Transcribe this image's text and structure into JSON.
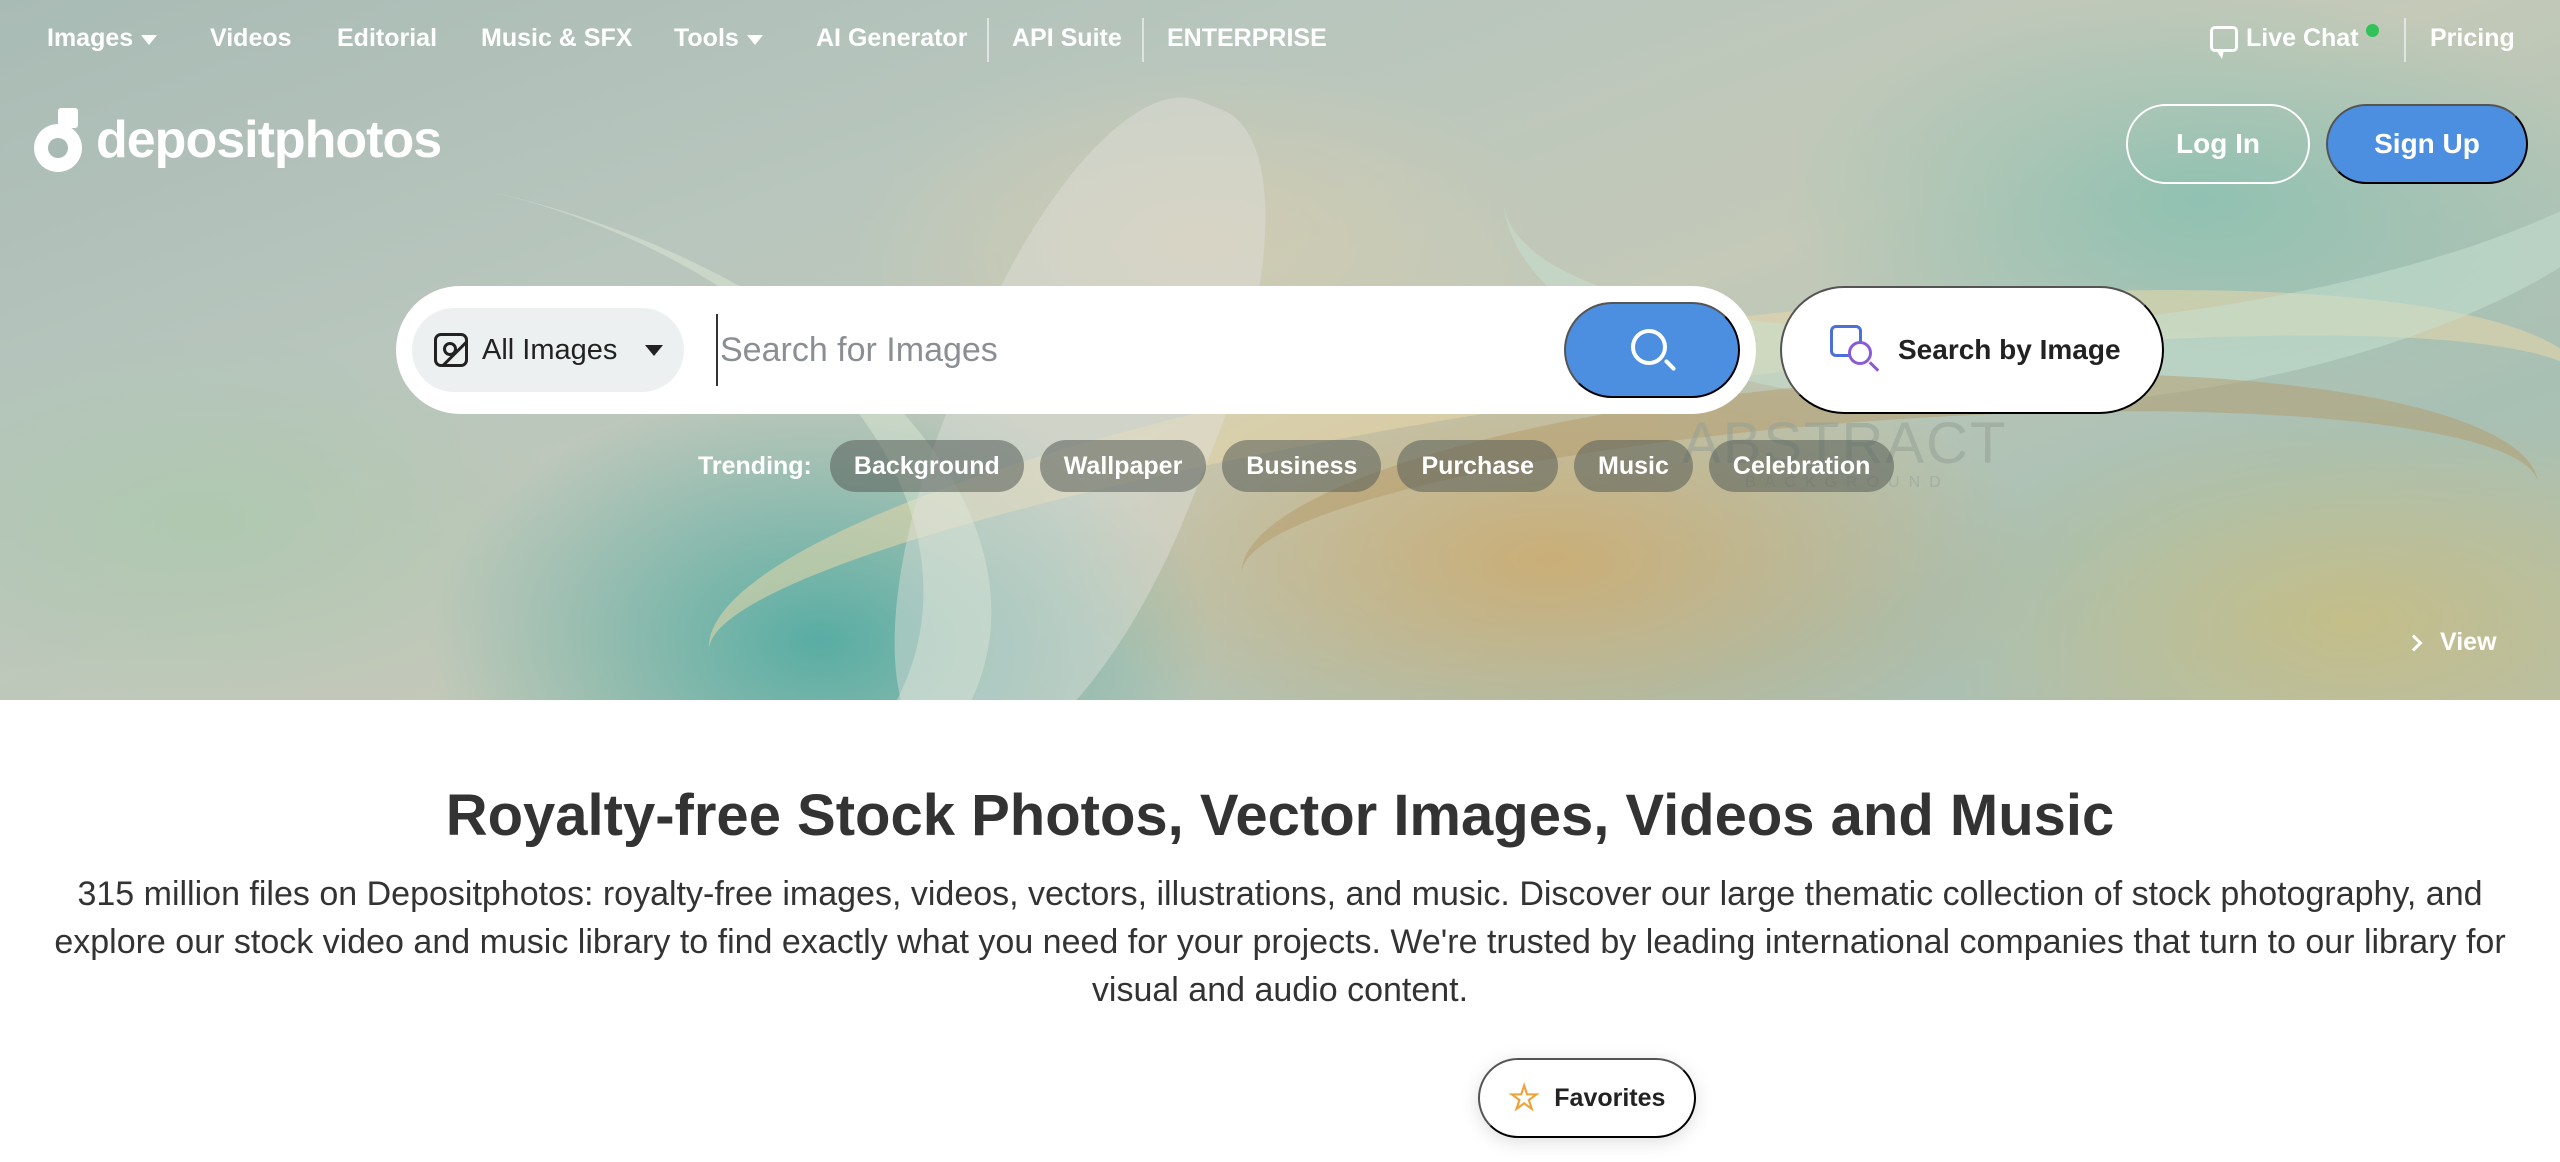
{
  "nav": {
    "images": "Images",
    "videos": "Videos",
    "editorial": "Editorial",
    "music": "Music & SFX",
    "tools": "Tools",
    "ai_generator": "AI Generator",
    "api_suite": "API Suite",
    "enterprise": "ENTERPRISE",
    "live_chat": "Live Chat",
    "pricing": "Pricing"
  },
  "logo": {
    "text": "depositphotos"
  },
  "auth": {
    "login": "Log In",
    "signup": "Sign Up"
  },
  "search": {
    "category": "All Images",
    "placeholder": "Search for Images",
    "search_by_image": "Search by Image"
  },
  "trending": {
    "label": "Trending:",
    "chips": [
      "Background",
      "Wallpaper",
      "Business",
      "Purchase",
      "Music",
      "Celebration"
    ]
  },
  "hero": {
    "overlay_title": "ABSTRACT",
    "overlay_sub": "BACKGROUND",
    "view_label": "View"
  },
  "content": {
    "title": "Royalty-free Stock Photos, Vector Images, Videos and Music",
    "description": "315 million files on Depositphotos: royalty-free images, videos, vectors, illustrations, and music. Discover our large thematic collection of stock photography, and explore our stock video and music library to find exactly what you need for your projects. We're trusted by leading international companies that turn to our library for visual and audio content.",
    "favorites": "Favorites"
  },
  "colors": {
    "accent": "#4c8fe0",
    "online": "#33c25a",
    "star": "#f0a23a"
  },
  "icons": {
    "category": "image-icon",
    "search": "search-icon",
    "search_by_image": "image-search-icon",
    "chat": "chat-icon",
    "favorites": "star-icon",
    "view": "chevron-right-icon"
  }
}
